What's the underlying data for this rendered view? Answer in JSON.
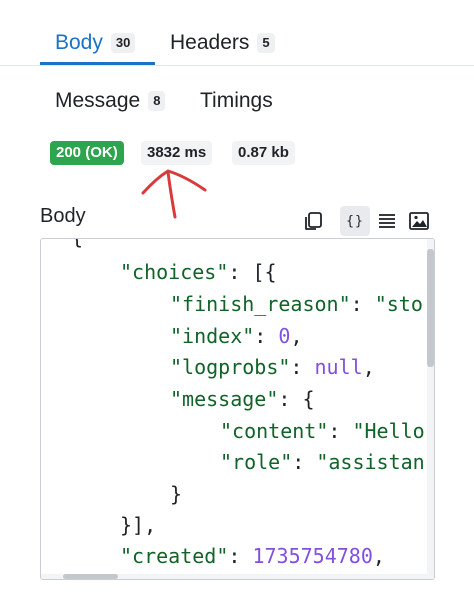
{
  "tabs": [
    {
      "label": "Body",
      "count": "30",
      "active": true
    },
    {
      "label": "Headers",
      "count": "5",
      "active": false
    },
    {
      "label": "Message",
      "count": "8",
      "active": false
    },
    {
      "label": "Timings",
      "active": false
    }
  ],
  "status": {
    "code_text": "200 (OK)",
    "time": "3832 ms",
    "size": "0.87 kb",
    "status_color": "#2da44e"
  },
  "body": {
    "title": "Body",
    "tools": [
      {
        "icon": "copy-icon"
      },
      {
        "icon": "braces-icon",
        "text": "{}",
        "active": true
      },
      {
        "icon": "text-lines-icon"
      },
      {
        "icon": "image-icon"
      }
    ]
  },
  "code": {
    "lines": {
      "l0": {
        "p1": "{"
      },
      "l1": {
        "k": "\"choices\"",
        "p": ": [{"
      },
      "l2": {
        "k": "\"finish_reason\"",
        "p": ": ",
        "v": "\"sto"
      },
      "l3": {
        "k": "\"index\"",
        "p": ": ",
        "v": "0",
        "e": ","
      },
      "l4": {
        "k": "\"logprobs\"",
        "p": ": ",
        "v": "null",
        "e": ","
      },
      "l5": {
        "k": "\"message\"",
        "p": ": {"
      },
      "l6": {
        "k": "\"content\"",
        "p": ": ",
        "v": "\"Hello"
      },
      "l7": {
        "k": "\"role\"",
        "p": ": ",
        "v": "\"assistan"
      },
      "l8": {
        "p1": "}"
      },
      "l9": {
        "p1": "}],"
      },
      "l10": {
        "k": "\"created\"",
        "p": ": ",
        "v": "1735754780",
        "e": ","
      }
    }
  },
  "colors": {
    "accent": "#1a73c7",
    "key": "#116329",
    "number": "#8250df",
    "annotation": "#d93a3a"
  }
}
